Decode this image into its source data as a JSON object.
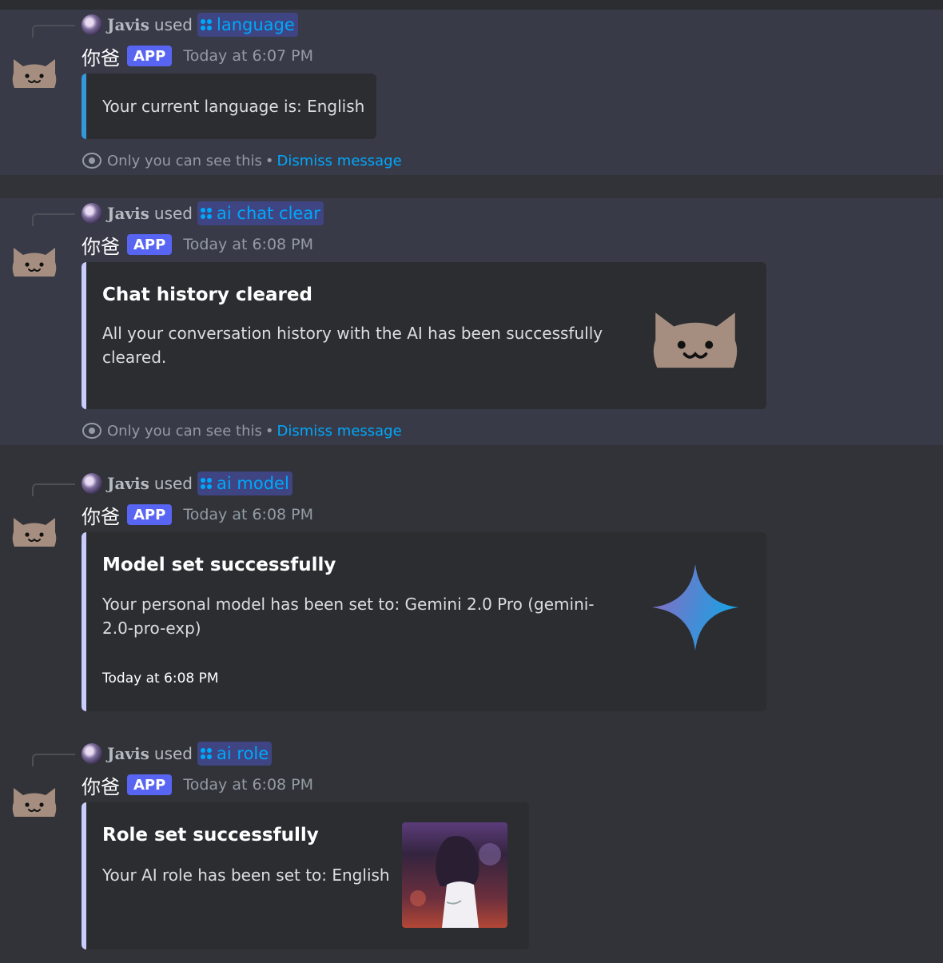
{
  "messages": [
    {
      "ref_user": "Javis",
      "ref_used": "used",
      "command": "language",
      "bot_name": "你爸",
      "badge": "APP",
      "timestamp": "Today at 6:07 PM",
      "embed_desc": "Your current language is: English",
      "ephemeral": {
        "note": "Only you can see this",
        "sep": "•",
        "dismiss": "Dismiss message"
      }
    },
    {
      "ref_user": "Javis",
      "ref_used": "used",
      "command": "ai chat clear",
      "bot_name": "你爸",
      "badge": "APP",
      "timestamp": "Today at 6:08 PM",
      "embed_title": "Chat history cleared",
      "embed_desc": "All your conversation history with the AI has been successfully cleared.",
      "thumbnail": "cat-face",
      "ephemeral": {
        "note": "Only you can see this",
        "sep": "•",
        "dismiss": "Dismiss message"
      }
    },
    {
      "ref_user": "Javis",
      "ref_used": "used",
      "command": "ai model",
      "bot_name": "你爸",
      "badge": "APP",
      "timestamp": "Today at 6:08 PM",
      "embed_title": "Model set successfully",
      "embed_desc": "Your personal model has been set to: Gemini 2.0 Pro (gemini-2.0-pro-exp)",
      "embed_footer": "Today at 6:08 PM",
      "thumbnail": "gemini-sparkle"
    },
    {
      "ref_user": "Javis",
      "ref_used": "used",
      "command": "ai role",
      "bot_name": "你爸",
      "badge": "APP",
      "timestamp": "Today at 6:08 PM",
      "embed_title": "Role set successfully",
      "embed_desc": "Your AI role has been set to: English",
      "thumbnail": "anime-girl-photo"
    }
  ],
  "colors": {
    "background": "#313338",
    "ephemeral_bg": "#393a48",
    "embed_bg": "#2b2d31",
    "blurple": "#5865f2",
    "link": "#00a8fc",
    "embed_accent_blue": "#3498db",
    "embed_accent_default": "#c9cdfb",
    "cat_fill": "#a58e80"
  }
}
